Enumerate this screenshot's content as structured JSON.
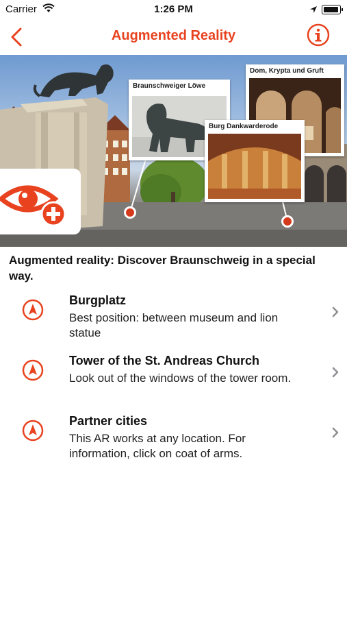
{
  "status_bar": {
    "carrier": "Carrier",
    "time": "1:26 PM"
  },
  "nav": {
    "title": "Augmented Reality",
    "back_icon": "chevron-left-icon",
    "info_icon": "info-circle-icon",
    "accent_color": "#e8421f"
  },
  "hero": {
    "cards": [
      {
        "caption": "Braunschweiger Löwe"
      },
      {
        "caption": "Dom, Krypta und Gruft"
      },
      {
        "caption": "Burg Dankwarderode"
      }
    ],
    "ar_button_icon": "eye-plus-icon"
  },
  "intro_text": "Augmented reality: Discover Braunschweig in a special way.",
  "locations": [
    {
      "name": "Burgplatz",
      "description": "Best position: between museum and lion statue"
    },
    {
      "name": "Tower of the St. Andreas Church",
      "description": "Look out of the windows of the tower room."
    },
    {
      "name": "Partner cities",
      "description": "This AR works at any location. For information, click on coat of arms."
    }
  ]
}
